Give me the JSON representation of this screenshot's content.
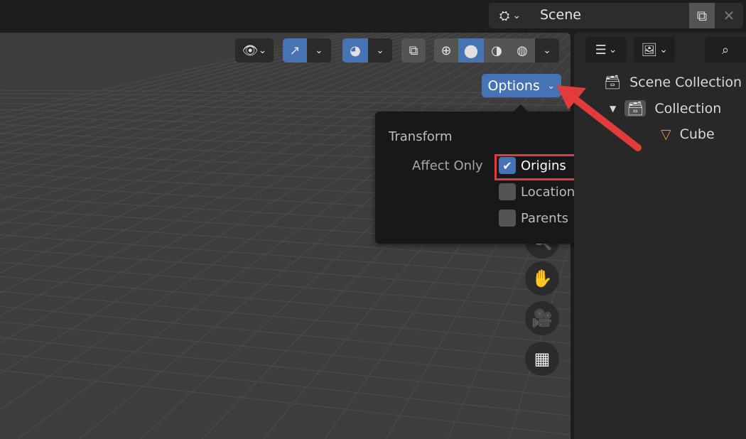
{
  "topbar": {
    "scene_icon": "scene-icon",
    "scene_name": "Scene",
    "copy_icon": "copy-icon",
    "close_icon": "close-icon"
  },
  "viewport_header": {
    "visibility_icon": "selectability-visibility-icon",
    "gizmo_icon": "gizmo-icon",
    "overlay_icon": "overlay-icon",
    "xray_icon": "xray-icon",
    "shading_modes": [
      "wireframe",
      "solid",
      "material-preview",
      "rendered"
    ],
    "active_shading": "solid",
    "options_label": "Options"
  },
  "options_popup": {
    "section": "Transform",
    "affect_only_label": "Affect Only",
    "checkboxes": [
      {
        "label": "Origins",
        "checked": true
      },
      {
        "label": "Locations",
        "checked": false
      },
      {
        "label": "Parents",
        "checked": false
      }
    ]
  },
  "nav_gizmos": [
    "zoom-icon",
    "hand-pan-icon",
    "camera-icon",
    "grid-ortho-icon"
  ],
  "outliner": {
    "items": [
      {
        "label": "Scene Collection",
        "icon": "scene-collection-icon"
      },
      {
        "label": "Collection",
        "icon": "collection-icon"
      },
      {
        "label": "Cube",
        "icon": "mesh-object-icon"
      }
    ]
  },
  "colors": {
    "accent": "#4772b3",
    "annotation": "#e23b3b",
    "object_orange": "#e38a3a"
  }
}
